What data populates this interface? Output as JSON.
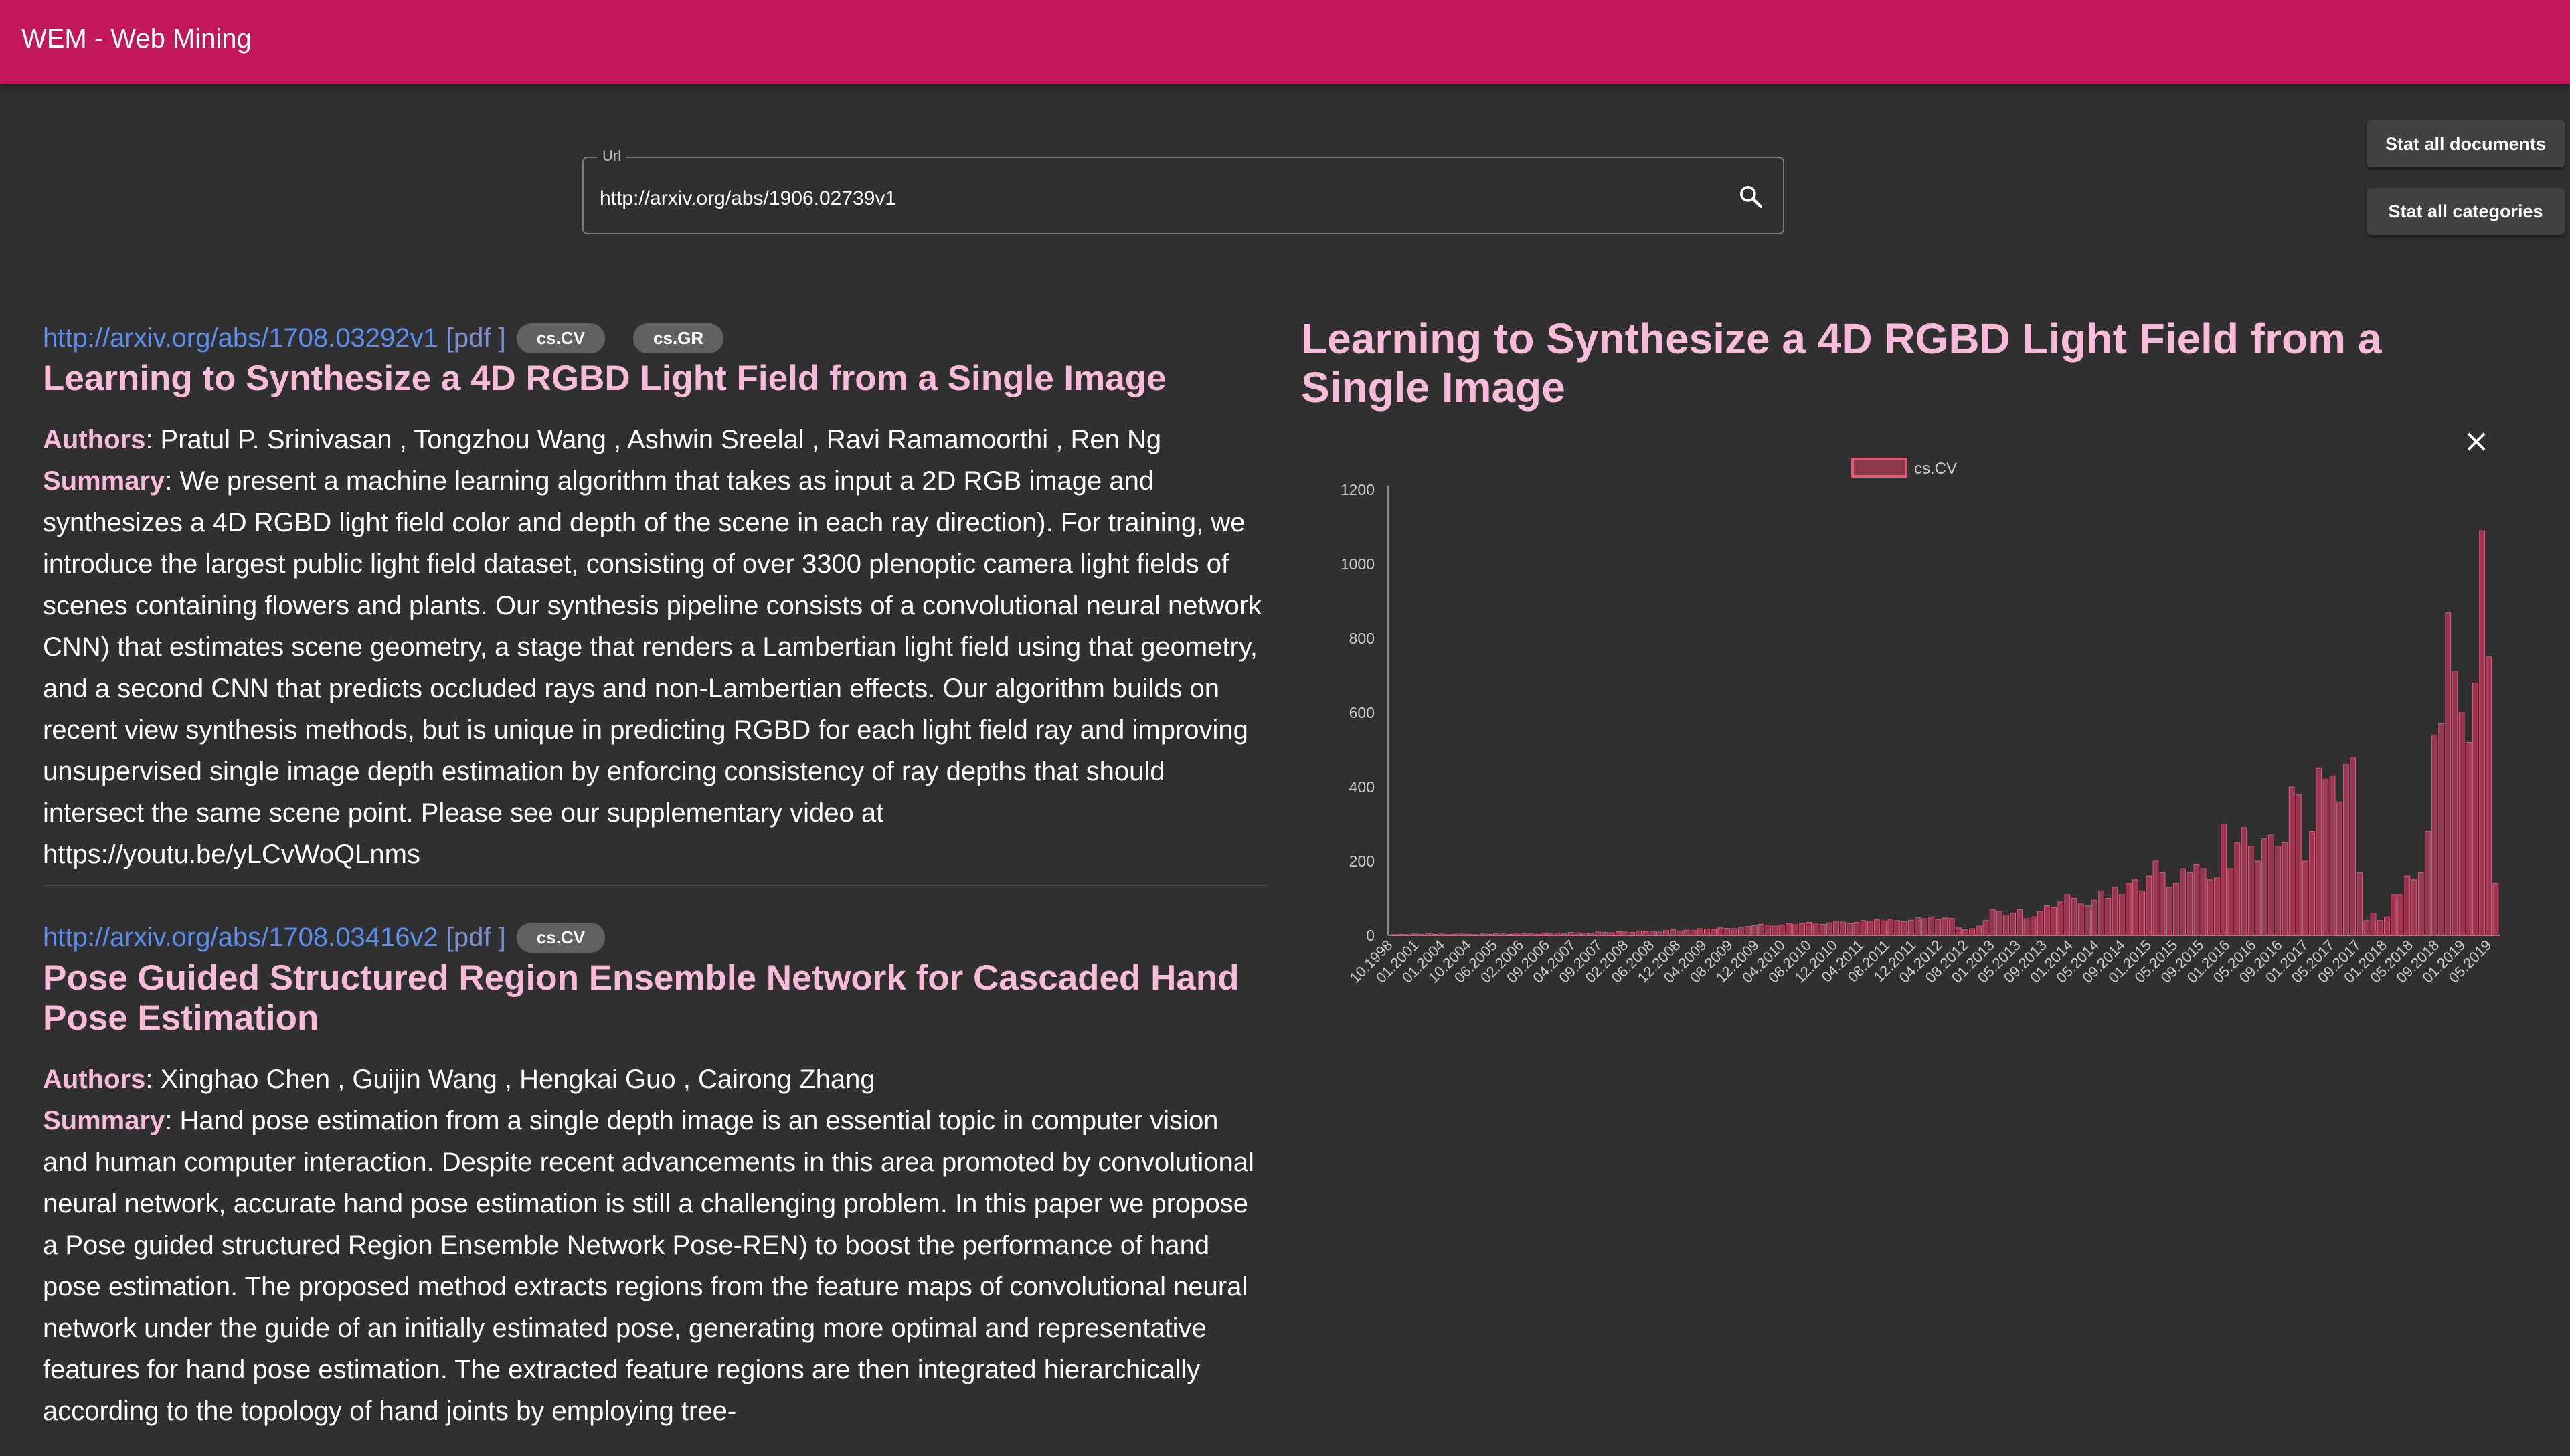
{
  "app": {
    "title": "WEM - Web Mining"
  },
  "search": {
    "label": "Url",
    "value": "http://arxiv.org/abs/1906.02739v1"
  },
  "actions": {
    "stat_docs": "Stat all documents",
    "stat_categories": "Stat all categories"
  },
  "papers": [
    {
      "url": "http://arxiv.org/abs/1708.03292v1",
      "pdf_open": "[",
      "pdf": "pdf",
      "pdf_close": "]",
      "categories": [
        "cs.CV",
        "cs.GR"
      ],
      "title": "Learning to Synthesize a 4D RGBD Light Field from a Single Image",
      "authors_label": "Authors",
      "authors": ": Pratul P. Srinivasan , Tongzhou Wang , Ashwin Sreelal , Ravi Ramamoorthi , Ren Ng",
      "summary_label": "Summary",
      "summary": ": We present a machine learning algorithm that takes as input a 2D RGB image and synthesizes a 4D RGBD light field color and depth of the scene in each ray direction). For training, we introduce the largest public light field dataset, consisting of over 3300 plenoptic camera light fields of scenes containing flowers and plants. Our synthesis pipeline consists of a convolutional neural network CNN) that estimates scene geometry, a stage that renders a Lambertian light field using that geometry, and a second CNN that predicts occluded rays and non-Lambertian effects. Our algorithm builds on recent view synthesis methods, but is unique in predicting RGBD for each light field ray and improving unsupervised single image depth estimation by enforcing consistency of ray depths that should intersect the same scene point. Please see our supplementary video at https://youtu.be/yLCvWoQLnms"
    },
    {
      "url": "http://arxiv.org/abs/1708.03416v2",
      "pdf_open": "[",
      "pdf": "pdf",
      "pdf_close": "]",
      "categories": [
        "cs.CV"
      ],
      "title": "Pose Guided Structured Region Ensemble Network for Cascaded Hand Pose Estimation",
      "authors_label": "Authors",
      "authors": ": Xinghao Chen , Guijin Wang , Hengkai Guo , Cairong Zhang",
      "summary_label": "Summary",
      "summary": ": Hand pose estimation from a single depth image is an essential topic in computer vision and human computer interaction. Despite recent advancements in this area promoted by convolutional neural network, accurate hand pose estimation is still a challenging problem. In this paper we propose a Pose guided structured Region Ensemble Network Pose-REN) to boost the performance of hand pose estimation. The proposed method extracts regions from the feature maps of convolutional neural network under the guide of an initially estimated pose, generating more optimal and representative features for hand pose estimation. The extracted feature regions are then integrated hierarchically according to the topology of hand joints by employing tree-"
    }
  ],
  "detail": {
    "title": "Learning to Synthesize a 4D RGBD Light Field from a Single Image"
  },
  "chart_data": {
    "type": "bar",
    "series": [
      {
        "name": "cs.CV",
        "color": "#e05a78"
      }
    ],
    "ylim": [
      0,
      1200
    ],
    "yticks": [
      0,
      200,
      400,
      600,
      800,
      1000,
      1200
    ],
    "xtick_labels": [
      "10.1998",
      "01.2001",
      "01.2004",
      "10.2004",
      "06.2005",
      "02.2006",
      "09.2006",
      "04.2007",
      "09.2007",
      "02.2008",
      "06.2008",
      "12.2008",
      "04.2009",
      "08.2009",
      "12.2009",
      "04.2010",
      "08.2010",
      "12.2010",
      "04.2011",
      "08.2011",
      "12.2011",
      "04.2012",
      "08.2012",
      "01.2013",
      "05.2013",
      "09.2013",
      "01.2014",
      "05.2014",
      "09.2014",
      "01.2015",
      "05.2015",
      "09.2015",
      "01.2016",
      "05.2016",
      "09.2016",
      "01.2017",
      "05.2017",
      "09.2017",
      "01.2018",
      "05.2018",
      "09.2018",
      "01.2019",
      "05.2019"
    ],
    "values": [
      2,
      3,
      2,
      4,
      3,
      5,
      3,
      4,
      2,
      3,
      4,
      3,
      2,
      4,
      3,
      5,
      4,
      3,
      6,
      5,
      4,
      3,
      7,
      5,
      6,
      4,
      8,
      7,
      6,
      5,
      9,
      8,
      7,
      10,
      9,
      8,
      12,
      10,
      11,
      9,
      13,
      15,
      12,
      14,
      13,
      18,
      17,
      16,
      20,
      19,
      18,
      22,
      24,
      26,
      30,
      28,
      25,
      27,
      32,
      29,
      31,
      35,
      33,
      30,
      34,
      38,
      36,
      32,
      35,
      40,
      38,
      42,
      39,
      44,
      40,
      37,
      41,
      48,
      45,
      50,
      43,
      47,
      46,
      20,
      15,
      18,
      25,
      40,
      70,
      65,
      55,
      60,
      70,
      45,
      50,
      65,
      80,
      75,
      90,
      110,
      100,
      85,
      80,
      95,
      120,
      100,
      130,
      110,
      140,
      150,
      120,
      160,
      200,
      170,
      130,
      140,
      180,
      170,
      190,
      180,
      150,
      155,
      300,
      180,
      250,
      290,
      240,
      200,
      260,
      270,
      240,
      250,
      400,
      380,
      200,
      280,
      450,
      420,
      430,
      360,
      460,
      480,
      170,
      40,
      60,
      40,
      50,
      110,
      110,
      160,
      150,
      170,
      280,
      540,
      570,
      870,
      710,
      600,
      520,
      680,
      1090,
      750,
      140
    ]
  }
}
